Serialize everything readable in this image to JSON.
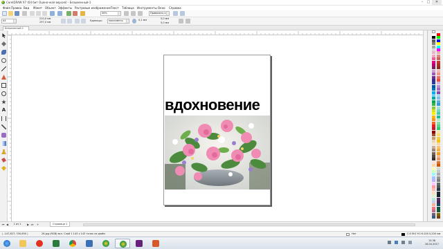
{
  "window": {
    "title": "CorelDRAW X7 (64 бит Оценочная версия) - Безымянный-1",
    "minimize": "–",
    "maximize": "□",
    "close": "✕"
  },
  "menu": [
    "Файл",
    "Правка",
    "Вид",
    "Макет",
    "Объект",
    "Эффекты",
    "Растровые изображения",
    "Текст",
    "Таблица",
    "Инструменты",
    "Окно",
    "Справка"
  ],
  "standard_toolbar": {
    "zoom_value": "56%",
    "snap_label": "Привязать к"
  },
  "property_bar": {
    "page_size": "A4",
    "width": "210,0 мм",
    "height": "297,0 мм",
    "units_label": "Единицы:",
    "units_value": "миллиметр",
    "nudge": "0,1 мм",
    "dup_x": "5,0 мм",
    "dup_y": "5,0 мм"
  },
  "document_tab": {
    "label": "Безымянный-1"
  },
  "canvas": {
    "headline": "вдохновение",
    "photo_description": "flower-bouquet-image"
  },
  "page_navigator": {
    "counter": "1 из 1",
    "page_tab": "Страница 1",
    "first": "⏮",
    "prev": "◀",
    "next": "▶",
    "last": "⏭",
    "add": "+"
  },
  "status_bar": {
    "coords": "( -147,827; 330,690 )",
    "selection": "26.jpg (RGB) вкл. Слой 1 143 х 143 точек на дюйм",
    "fill": "Нет",
    "outline": "C:0 M:0 Y:0 K:100  0,200 мм"
  },
  "taskbar": {
    "clock_time": "13:38",
    "clock_date": "26.04.2017"
  },
  "colors": {
    "accent_blue": "#1f5fb5",
    "headline": "#000000",
    "page_shadow": "#5d5d5d"
  }
}
